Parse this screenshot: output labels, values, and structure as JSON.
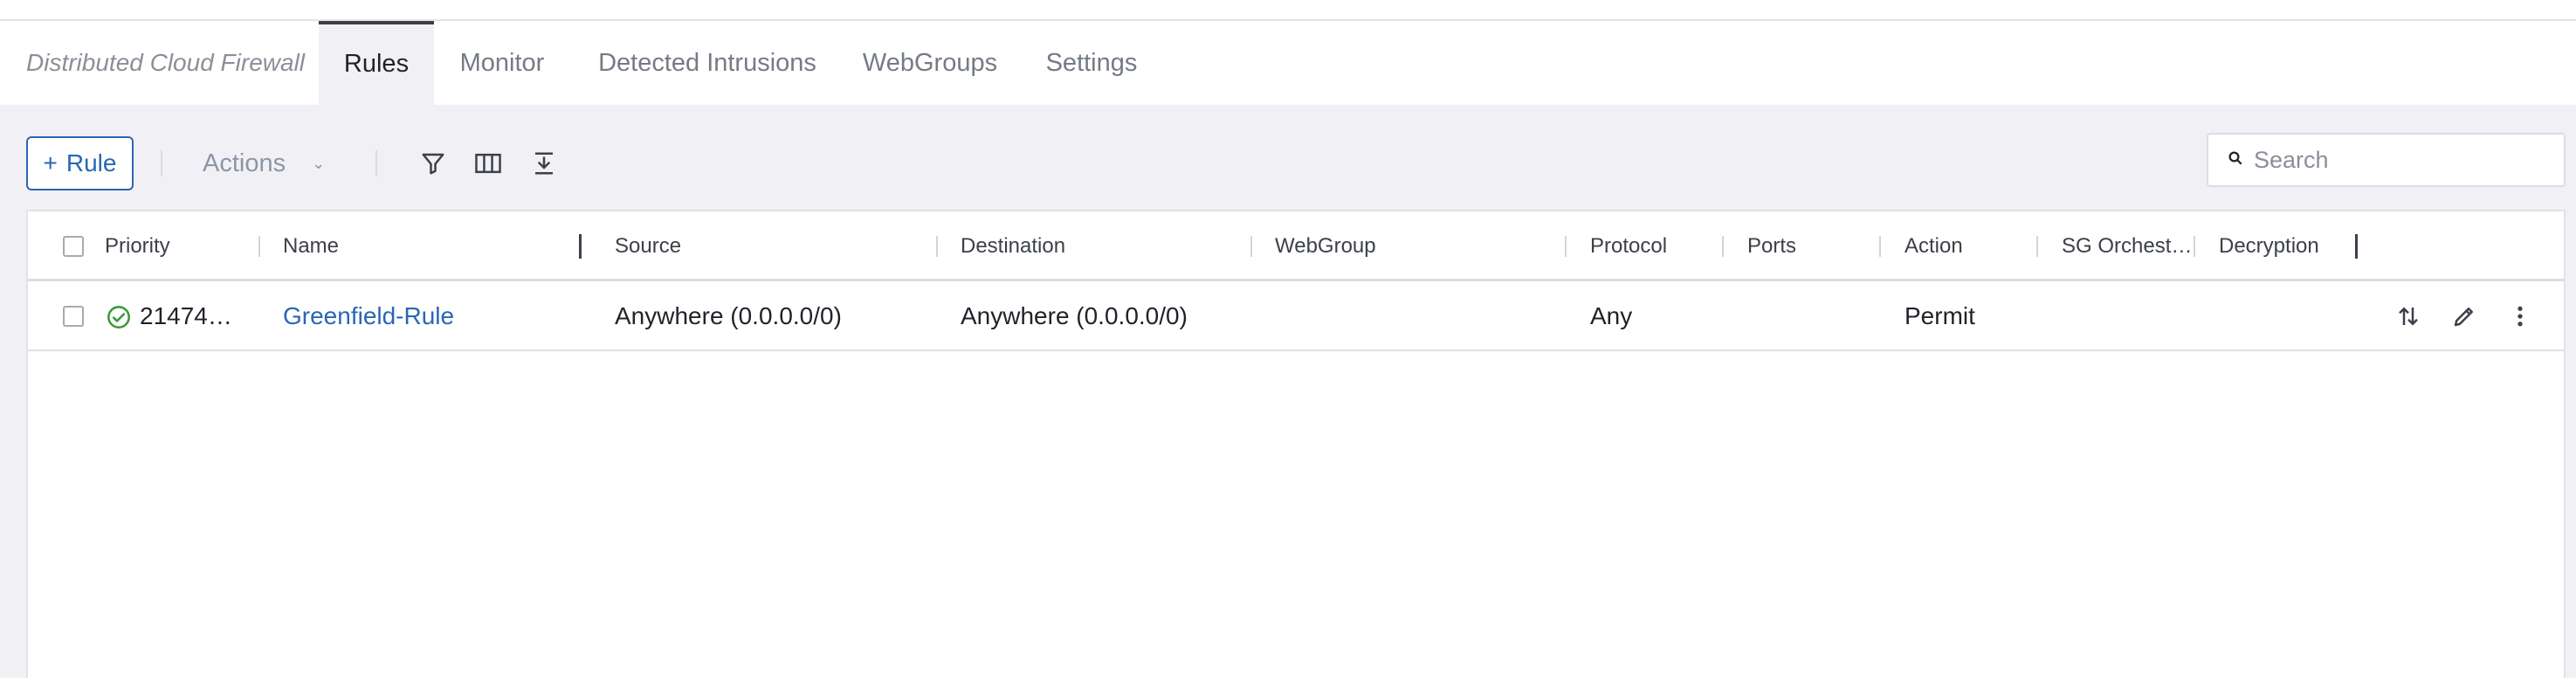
{
  "tabs": {
    "breadcrumb": "Distributed Cloud Firewall",
    "items": [
      "Rules",
      "Monitor",
      "Detected Intrusions",
      "WebGroups",
      "Settings"
    ],
    "active": "Rules"
  },
  "toolbar": {
    "add_rule_plus": "+",
    "add_rule_label": "Rule",
    "actions_label": "Actions",
    "actions_chevron": "⌄",
    "icons": [
      "filter-icon",
      "columns-icon",
      "download-icon"
    ]
  },
  "search": {
    "placeholder": "Search",
    "value": ""
  },
  "table": {
    "columns": [
      "Priority",
      "Name",
      "Source",
      "Destination",
      "WebGroup",
      "Protocol",
      "Ports",
      "Action",
      "SG Orchest…",
      "Decryption"
    ],
    "rows": [
      {
        "status": "success-check",
        "priority": "21474…",
        "name": "Greenfield-Rule",
        "source": "Anywhere (0.0.0.0/0)",
        "destination": "Anywhere (0.0.0.0/0)",
        "webgroup": "",
        "protocol": "Any",
        "ports": "",
        "action": "Permit",
        "sg_orchestration": "",
        "decryption": ""
      }
    ],
    "row_actions": [
      "reorder-icon",
      "edit-icon",
      "more-vertical-icon"
    ]
  },
  "colors": {
    "accent": "#2a66b3",
    "success": "#3a9a3a",
    "page_bg": "#f1f1f5"
  }
}
